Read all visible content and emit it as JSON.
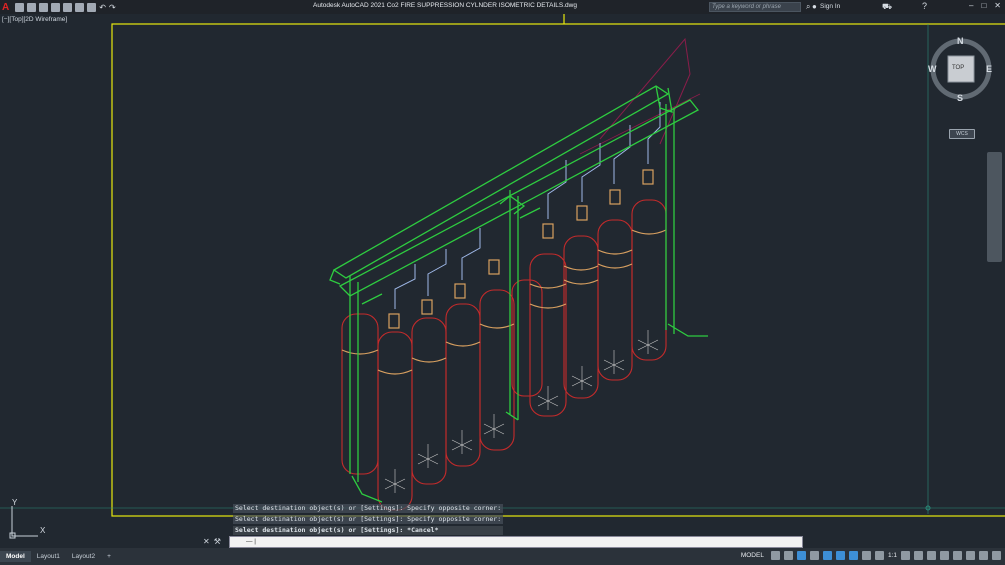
{
  "app": {
    "title": "Autodesk AutoCAD 2021    Co2 FIRE SUPPRESSION CYLNDER ISOMETRIC DETAILS.dwg",
    "search_placeholder": "Type a keyword or phrase",
    "sign_in": "Sign In"
  },
  "viewport": {
    "label": "[−][Top][2D Wireframe]",
    "compass": {
      "north": "N",
      "south": "S",
      "east": "E",
      "west": "W",
      "center": "TOP"
    },
    "wcs": "WCS",
    "ucs_y": "Y",
    "ucs_x": "X"
  },
  "command": {
    "history": [
      "Select destination object(s) or [Settings]: Specify opposite corner:",
      "Select destination object(s) or [Settings]: Specify opposite corner:",
      "Select destination object(s) or [Settings]: *Cancel*"
    ],
    "prompt": "— |"
  },
  "tabs": [
    "Model",
    "Layout1",
    "Layout2",
    "+"
  ],
  "status": {
    "model_label": "MODEL",
    "scale": "1:1"
  },
  "colors": {
    "frame": "#e8e80e",
    "pipe": "#2ecc40",
    "cylinder": "#c62b2b",
    "valve": "#d8a060",
    "bg": "#212830"
  }
}
